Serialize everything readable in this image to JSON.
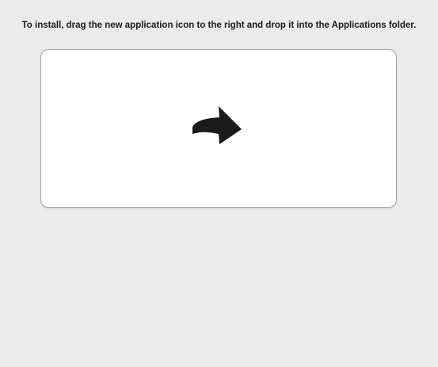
{
  "window": {
    "instruction": "To install, drag the new application icon to the right and drop it into the Applications folder."
  },
  "panel": {
    "icon": "curved-arrow-right-icon",
    "icon_color": "#1a1a1a",
    "background": "#ffffff",
    "border_color": "#a6a6a6"
  },
  "colors": {
    "window_background": "#ebebeb",
    "text": "#1a1a1a"
  }
}
